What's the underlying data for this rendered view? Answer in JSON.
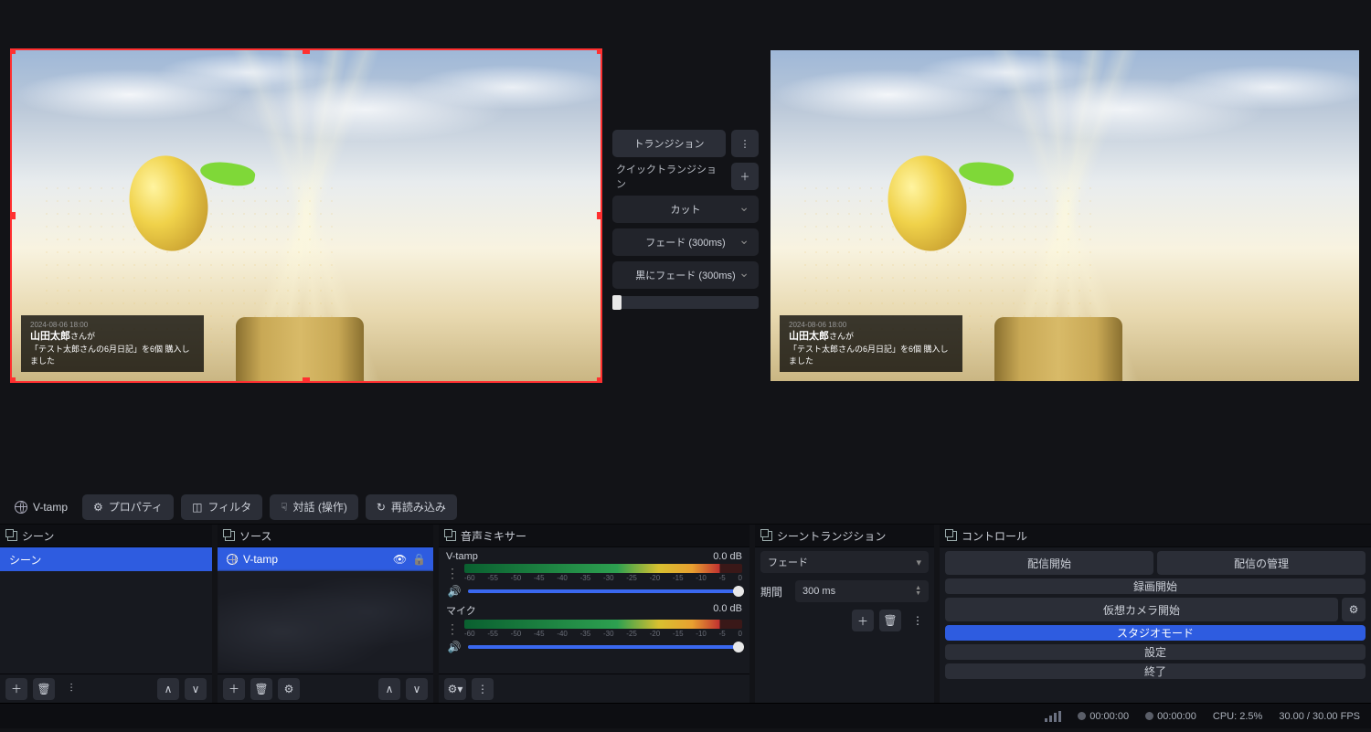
{
  "preview": {
    "overlay_time": "2024-08-06 18:00",
    "overlay_name": "山田太郎",
    "overlay_suffix": "さんが",
    "overlay_line2": "「テスト太郎さんの6月日記」を6個 購入しました"
  },
  "center": {
    "transition_btn": "トランジション",
    "quick_label": "クイックトランジション",
    "items": [
      "カット",
      "フェード (300ms)",
      "黒にフェード (300ms)"
    ]
  },
  "toolbar": {
    "source_name": "V-tamp",
    "properties": "プロパティ",
    "filters": "フィルタ",
    "interact": "対話 (操作)",
    "reload": "再読み込み"
  },
  "panels": {
    "scenes_title": "シーン",
    "sources_title": "ソース",
    "mixer_title": "音声ミキサー",
    "trans_title": "シーントランジション",
    "controls_title": "コントロール"
  },
  "scenes": {
    "items": [
      "シーン"
    ]
  },
  "sources": {
    "items": [
      "V-tamp"
    ]
  },
  "mixer": {
    "channels": [
      {
        "name": "V-tamp",
        "db": "0.0 dB"
      },
      {
        "name": "マイク",
        "db": "0.0 dB"
      }
    ],
    "ticks": [
      "-60",
      "-55",
      "-50",
      "-45",
      "-40",
      "-35",
      "-30",
      "-25",
      "-20",
      "-15",
      "-10",
      "-5",
      "0"
    ]
  },
  "transition": {
    "selected": "フェード",
    "duration_label": "期間",
    "duration_value": "300 ms"
  },
  "controls": {
    "start_stream": "配信開始",
    "manage_stream": "配信の管理",
    "start_record": "録画開始",
    "virtual_cam": "仮想カメラ開始",
    "studio": "スタジオモード",
    "settings": "設定",
    "exit": "終了"
  },
  "status": {
    "live_time": "00:00:00",
    "rec_time": "00:00:00",
    "cpu": "CPU: 2.5%",
    "fps": "30.00 / 30.00 FPS"
  }
}
